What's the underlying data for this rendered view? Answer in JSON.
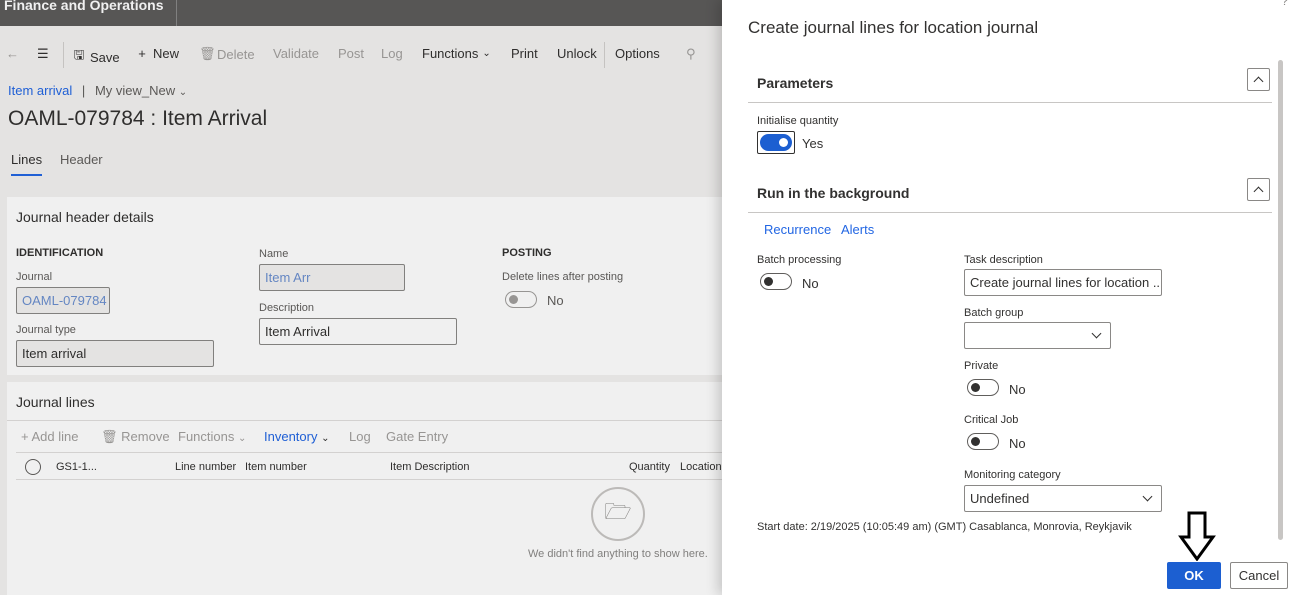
{
  "app": {
    "name": "Finance and Operations"
  },
  "actionbar": {
    "save": "Save",
    "new": "New",
    "delete": "Delete",
    "validate": "Validate",
    "post": "Post",
    "log": "Log",
    "functions": "Functions",
    "print": "Print",
    "unlock": "Unlock",
    "options": "Options"
  },
  "breadcrumb": {
    "link": "Item arrival",
    "separator": "|",
    "view": "My view_New"
  },
  "page": {
    "title": "OAML-079784 : Item Arrival",
    "tabs": [
      "Lines",
      "Header"
    ]
  },
  "header_details": {
    "title": "Journal header details",
    "identification": "IDENTIFICATION",
    "journal_label": "Journal",
    "journal_value": "OAML-079784",
    "journal_type_label": "Journal type",
    "journal_type_value": "Item arrival",
    "name_label": "Name",
    "name_value": "Item Arr",
    "description_label": "Description",
    "description_value": "Item Arrival",
    "posting": "POSTING",
    "delete_after_label": "Delete lines after posting",
    "delete_after_value": "No"
  },
  "journal_lines": {
    "title": "Journal lines",
    "toolbar": {
      "add_line": "Add line",
      "remove": "Remove",
      "functions": "Functions",
      "inventory": "Inventory",
      "log": "Log",
      "gate_entry": "Gate Entry"
    },
    "columns": [
      "GS1-1...",
      "Line number",
      "Item number",
      "Item Description",
      "Quantity",
      "Location"
    ],
    "empty_message": "We didn't find anything to show here."
  },
  "dialog": {
    "help": "?",
    "title": "Create journal lines for location journal",
    "parameters": {
      "title": "Parameters",
      "init_qty_label": "Initialise quantity",
      "init_qty_value": "Yes"
    },
    "background": {
      "title": "Run in the background",
      "links": [
        "Recurrence",
        "Alerts"
      ],
      "batch_processing_label": "Batch processing",
      "batch_processing_value": "No",
      "task_description_label": "Task description",
      "task_description_value": "Create journal lines for location ...",
      "batch_group_label": "Batch group",
      "batch_group_value": "",
      "private_label": "Private",
      "private_value": "No",
      "critical_job_label": "Critical Job",
      "critical_job_value": "No",
      "monitoring_category_label": "Monitoring category",
      "monitoring_category_value": "Undefined",
      "start_date": "Start date: 2/19/2025 (10:05:49 am) (GMT) Casablanca, Monrovia, Reykjavik"
    },
    "ok": "OK",
    "cancel": "Cancel"
  }
}
